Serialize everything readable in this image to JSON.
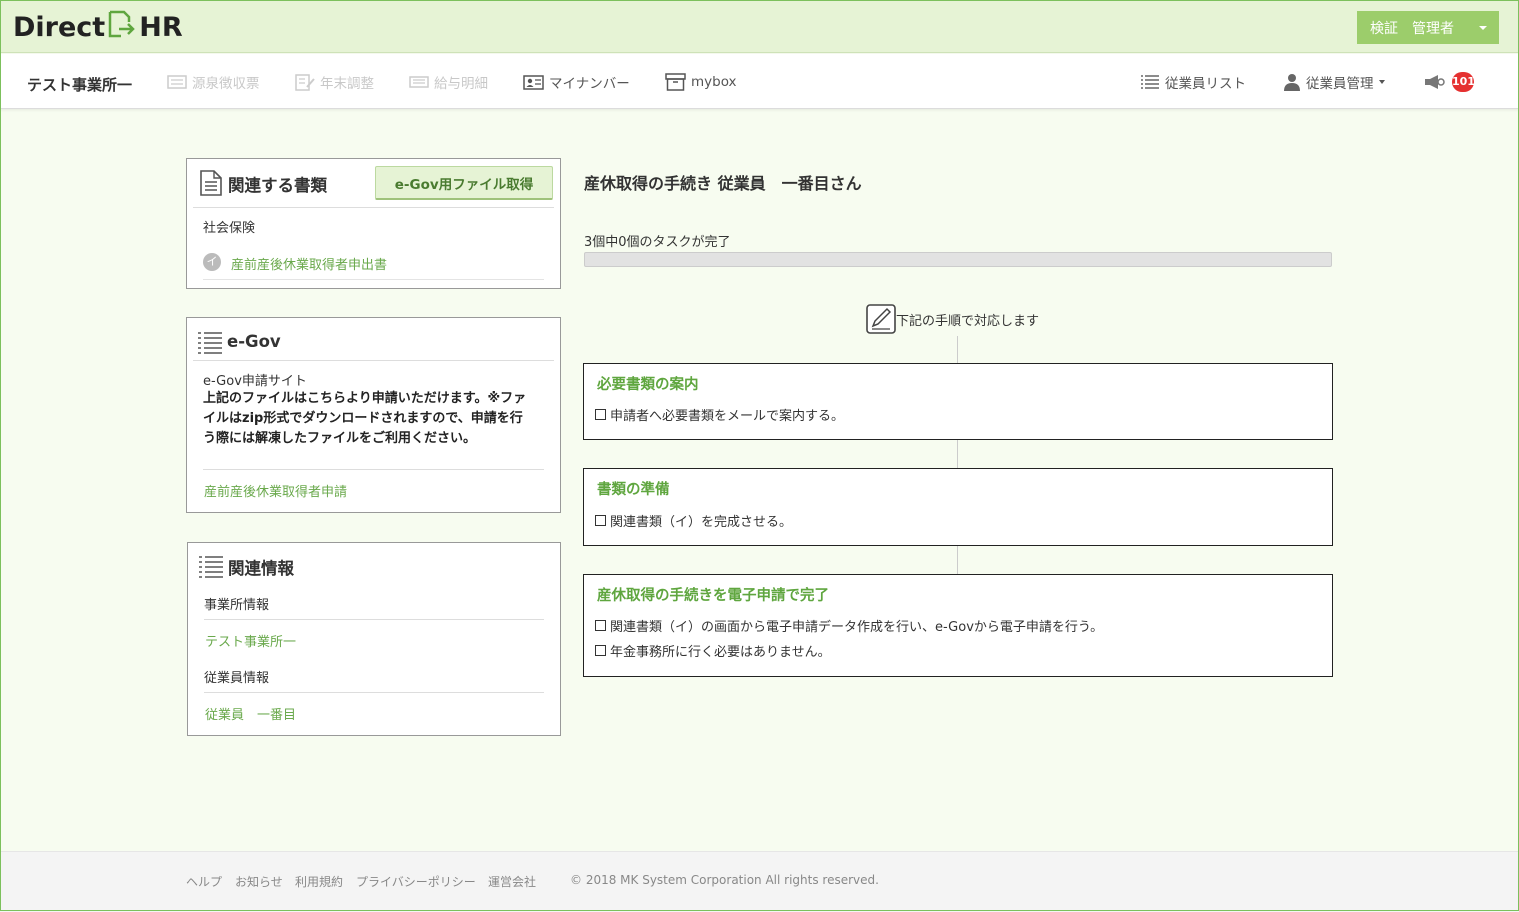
{
  "header": {
    "logo_text_left": "Direct",
    "logo_text_right": "HR",
    "user_menu_label": "検証　管理者"
  },
  "nav": {
    "office_name": "テスト事業所一",
    "items": [
      {
        "label": "源泉徴収票",
        "icon": "receipt-icon",
        "state": "disabled"
      },
      {
        "label": "年末調整",
        "icon": "edit-document-icon",
        "state": "disabled"
      },
      {
        "label": "給与明細",
        "icon": "payslip-icon",
        "state": "disabled"
      },
      {
        "label": "マイナンバー",
        "icon": "id-card-icon",
        "state": "active"
      },
      {
        "label": "mybox",
        "icon": "box-icon",
        "state": "active"
      }
    ],
    "right_items": [
      {
        "label": "従業員リスト",
        "icon": "list-icon"
      },
      {
        "label": "従業員管理",
        "icon": "user-icon"
      }
    ],
    "notification_count": "101"
  },
  "docs_panel": {
    "title": "関連する書類",
    "button_label": "e-Gov用ファイル取得",
    "category": "社会保険",
    "doc_marker": "イ",
    "doc_link": "産前産後休業取得者申出書"
  },
  "egov_panel": {
    "title": "e-Gov",
    "site_label": "e-Gov申請サイト",
    "note": "上記のファイルはこちらより申請いただけます。※ファイルはzip形式でダウンロードされますので、申請を行う際には解凍したファイルをご利用ください。",
    "link": "産前産後休業取得者申請"
  },
  "info_panel": {
    "title": "関連情報",
    "office_label": "事業所情報",
    "office_link": "テスト事業所一",
    "employee_label": "従業員情報",
    "employee_link": "従業員　一番目"
  },
  "main": {
    "title": "産休取得の手続き  従業員　一番目さん",
    "progress_text": "3個中0個のタスクが完了",
    "progress_fraction": 0,
    "step_hint": "下記の手順で対応します",
    "tasks": [
      {
        "title": "必要書類の案内",
        "items": [
          "申請者へ必要書類をメールで案内する。"
        ]
      },
      {
        "title": "書類の準備",
        "items": [
          "関連書類（イ）を完成させる。"
        ]
      },
      {
        "title": "産休取得の手続きを電子申請で完了",
        "items": [
          "関連書類（イ）の画面から電子申請データ作成を行い、e-Govから電子申請を行う。",
          "年金事務所に行く必要はありません。"
        ]
      }
    ]
  },
  "footer": {
    "links": [
      "ヘルプ",
      "お知らせ",
      "利用規約",
      "プライバシーポリシー",
      "運営会社"
    ],
    "copyright": "© 2018 MK System Corporation All rights reserved."
  },
  "colors": {
    "brand_green": "#9ccd6b",
    "link_green": "#6aa94c",
    "header_bg": "#e6f3d5",
    "badge_red": "#e53030"
  }
}
